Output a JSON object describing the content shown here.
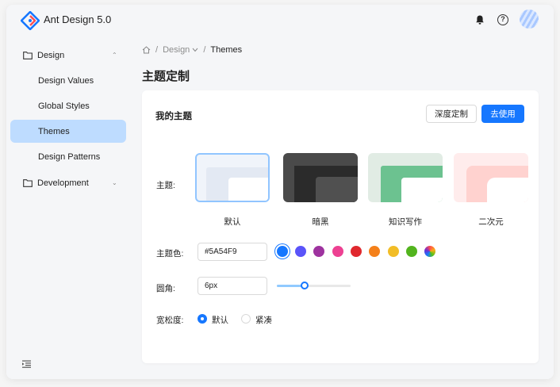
{
  "app": {
    "brand": "Ant Design 5.0"
  },
  "header": {
    "icons": [
      "bell-icon",
      "question-circle-icon"
    ],
    "avatar": "user-avatar"
  },
  "sidebar": {
    "items": [
      {
        "label": "Design",
        "type": "group",
        "expanded": true
      },
      {
        "label": "Design Values",
        "type": "item"
      },
      {
        "label": "Global Styles",
        "type": "item"
      },
      {
        "label": "Themes",
        "type": "item",
        "active": true
      },
      {
        "label": "Design Patterns",
        "type": "item"
      },
      {
        "label": "Development",
        "type": "group",
        "expanded": false
      }
    ]
  },
  "breadcrumb": {
    "home_icon": "home-icon",
    "sep": "/",
    "section": "Design",
    "current": "Themes"
  },
  "page": {
    "title": "主题定制"
  },
  "card": {
    "title": "我的主题",
    "custom_button": "深度定制",
    "use_button": "去使用",
    "theme_label": "主题:",
    "themes": [
      {
        "name": "默认",
        "selected": true
      },
      {
        "name": "暗黑"
      },
      {
        "name": "知识写作"
      },
      {
        "name": "二次元"
      }
    ],
    "color_label": "主题色:",
    "color_value": "#5A54F9",
    "swatches": [
      "#1677ff",
      "#5a54f9",
      "#9e339f",
      "#ed4192",
      "#e0282e",
      "#f4801a",
      "#f2bd27",
      "#52b41e",
      "conic"
    ],
    "radius_label": "圆角:",
    "radius_value": "6px",
    "radius_slider_fraction": 0.38,
    "compact_label": "宽松度:",
    "compact_options": [
      {
        "label": "默认",
        "checked": true
      },
      {
        "label": "紧凑",
        "checked": false
      }
    ]
  },
  "colors": {
    "primary": "#1677ff",
    "active_bg": "#bedcff"
  }
}
